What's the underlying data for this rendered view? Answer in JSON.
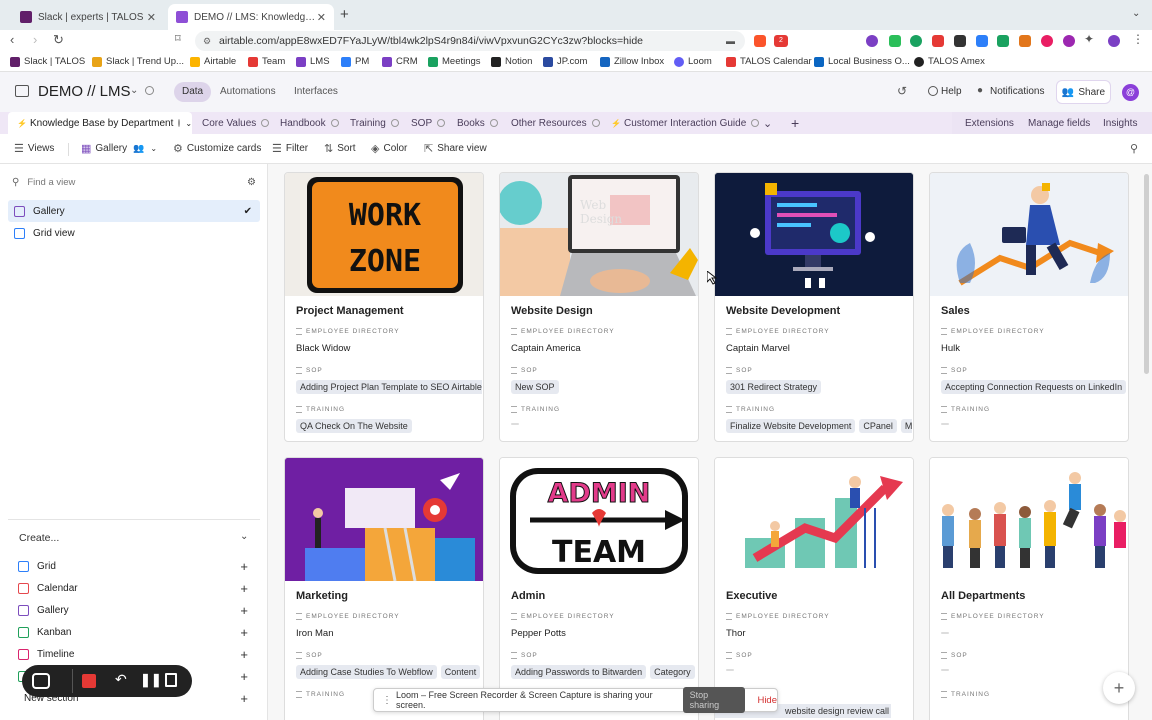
{
  "browser": {
    "tabs": [
      {
        "title": "Slack | experts | TALOS",
        "active": false
      },
      {
        "title": "DEMO // LMS: Knowledge Base",
        "active": true
      }
    ],
    "url": "airtable.com/appE8wxED7FYaJLyW/tbl4wk2lpS4r9n84i/viwVpxvunG2CYc3zw?blocks=hide",
    "extension_badge": "2",
    "bookmarks": [
      "Slack | TALOS",
      "Slack | Trend Up...",
      "Airtable",
      "Team",
      "LMS",
      "PM",
      "CRM",
      "Meetings",
      "Notion",
      "JP.com",
      "Zillow Inbox",
      "Loom",
      "TALOS Calendar",
      "Local Business O...",
      "TALOS Amex"
    ]
  },
  "app": {
    "base_name": "DEMO // LMS",
    "nav": [
      "Data",
      "Automations",
      "Interfaces"
    ],
    "active_nav": "Data",
    "help": "Help",
    "notifications": "Notifications",
    "share": "Share"
  },
  "table_tabs": [
    "Knowledge Base by Department",
    "Core Values",
    "Handbook",
    "Training",
    "SOP",
    "Books",
    "Other Resources",
    "Customer Interaction Guide"
  ],
  "right_links": [
    "Extensions",
    "Manage fields",
    "Insights"
  ],
  "toolbar": {
    "views": "Views",
    "gallery": "Gallery",
    "customize": "Customize cards",
    "filter": "Filter",
    "sort": "Sort",
    "color": "Color",
    "share_view": "Share view"
  },
  "sidebar": {
    "find_placeholder": "Find a view",
    "views": [
      "Gallery",
      "Grid view"
    ],
    "create_label": "Create...",
    "create_items": [
      "Grid",
      "Calendar",
      "Gallery",
      "Kanban",
      "Timeline"
    ],
    "new_section": "New section"
  },
  "field_labels": {
    "employee": "EMPLOYEE DIRECTORY",
    "sop": "SOP",
    "training": "TRAINING"
  },
  "cards": [
    {
      "title": "Project Management",
      "employee": "Black Widow",
      "sop": [
        "Adding Project Plan Template to SEO Airtable"
      ],
      "training": [
        "QA Check On The Website"
      ],
      "image": "work-zone-sign",
      "image_text": [
        "WORK",
        "ZONE"
      ]
    },
    {
      "title": "Website Design",
      "employee": "Captain America",
      "sop": [
        "New SOP"
      ],
      "training": [],
      "image": "web-design-laptop",
      "image_text": [
        "Web",
        "Design"
      ]
    },
    {
      "title": "Website Development",
      "employee": "Captain Marvel",
      "sop": [
        "301 Redirect Strategy"
      ],
      "training": [
        "Finalize Website Development",
        "CPanel",
        "M"
      ],
      "image": "monitor-illustration",
      "image_text": []
    },
    {
      "title": "Sales",
      "employee": "Hulk",
      "sop": [
        "Accepting Connection Requests on LinkedIn"
      ],
      "training": [],
      "image": "sales-growth",
      "image_text": []
    },
    {
      "title": "Marketing",
      "employee": "Iron Man",
      "sop": [
        "Adding Case Studies To Webflow",
        "Content"
      ],
      "training": [],
      "image": "marketing-team",
      "image_text": []
    },
    {
      "title": "Admin",
      "employee": "Pepper Potts",
      "sop": [
        "Adding Passwords to Bitwarden",
        "Category"
      ],
      "training": [],
      "image": "admin-team-logo",
      "image_text": [
        "ADMIN",
        "TEAM"
      ]
    },
    {
      "title": "Executive",
      "employee": "Thor",
      "sop": [],
      "training": [
        "website design review call (h"
      ],
      "image": "executive-growth",
      "image_text": []
    },
    {
      "title": "All Departments",
      "employee": "",
      "sop": [],
      "training": [],
      "image": "people-group",
      "image_text": []
    }
  ],
  "recorder": {
    "icons": [
      "camera-icon",
      "stop-icon",
      "undo-icon",
      "pause-icon",
      "trash-icon"
    ]
  },
  "loom_banner": {
    "text": "Loom – Free Screen Recorder & Screen Capture is sharing your screen.",
    "stop": "Stop sharing",
    "hide": "Hide"
  },
  "colors": {
    "accent_purple": "#7c4dbd",
    "airtable_blue": "#2d7ff9",
    "tab_bar": "#efe7f6"
  }
}
